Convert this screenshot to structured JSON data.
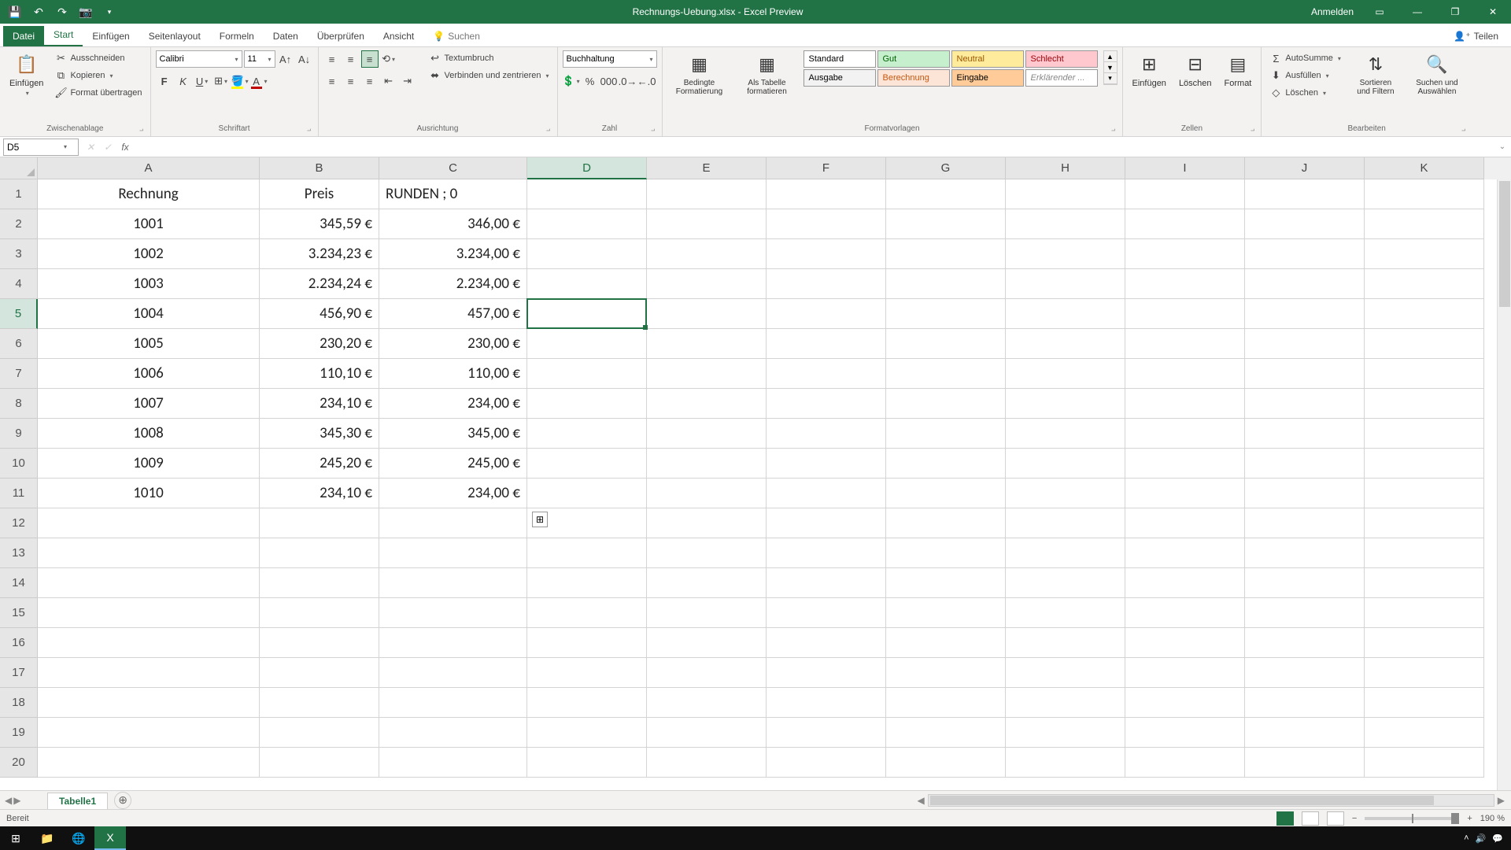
{
  "title": "Rechnungs-Uebung.xlsx - Excel Preview",
  "login": "Anmelden",
  "tabs": {
    "file": "Datei",
    "home": "Start",
    "insert": "Einfügen",
    "page": "Seitenlayout",
    "formulas": "Formeln",
    "data": "Daten",
    "review": "Überprüfen",
    "view": "Ansicht",
    "search": "Suchen",
    "share": "Teilen"
  },
  "clipboard": {
    "paste": "Einfügen",
    "cut": "Ausschneiden",
    "copy": "Kopieren",
    "painter": "Format übertragen",
    "label": "Zwischenablage"
  },
  "font": {
    "name": "Calibri",
    "size": "11",
    "label": "Schriftart"
  },
  "align": {
    "wrap": "Textumbruch",
    "merge": "Verbinden und zentrieren",
    "label": "Ausrichtung"
  },
  "number": {
    "format": "Buchhaltung",
    "label": "Zahl"
  },
  "styles": {
    "cond": "Bedingte Formatierung",
    "table": "Als Tabelle formatieren",
    "standard": "Standard",
    "gut": "Gut",
    "neutral": "Neutral",
    "schlecht": "Schlecht",
    "ausgabe": "Ausgabe",
    "berechnung": "Berechnung",
    "eingabe": "Eingabe",
    "erklar": "Erklärender ...",
    "label": "Formatvorlagen"
  },
  "cells": {
    "insert": "Einfügen",
    "delete": "Löschen",
    "format": "Format",
    "label": "Zellen"
  },
  "editing": {
    "sum": "AutoSumme",
    "fill": "Ausfüllen",
    "clear": "Löschen",
    "sort": "Sortieren und Filtern",
    "find": "Suchen und Auswählen",
    "label": "Bearbeiten"
  },
  "namebox": "D5",
  "formula": "",
  "columns": [
    "A",
    "B",
    "C",
    "D",
    "E",
    "F",
    "G",
    "H",
    "I",
    "J",
    "K"
  ],
  "colWidths": [
    "cA",
    "cB",
    "cC",
    "cD",
    "cE",
    "cF",
    "cG",
    "cH",
    "cI",
    "cJ",
    "cK"
  ],
  "selectedCol": 3,
  "selectedRow": 4,
  "rows": [
    {
      "n": "1",
      "cells": [
        {
          "v": "Rechnung",
          "a": "ac"
        },
        {
          "v": "Preis",
          "a": "ac"
        },
        {
          "v": "RUNDEN ; 0",
          "a": "al"
        },
        {
          "v": ""
        },
        {
          "v": ""
        },
        {
          "v": ""
        },
        {
          "v": ""
        },
        {
          "v": ""
        },
        {
          "v": ""
        },
        {
          "v": ""
        },
        {
          "v": ""
        }
      ]
    },
    {
      "n": "2",
      "cells": [
        {
          "v": "1001",
          "a": "ac"
        },
        {
          "v": "345,59 €",
          "a": "ar"
        },
        {
          "v": "346,00 €",
          "a": "ar"
        },
        {
          "v": ""
        },
        {
          "v": ""
        },
        {
          "v": ""
        },
        {
          "v": ""
        },
        {
          "v": ""
        },
        {
          "v": ""
        },
        {
          "v": ""
        },
        {
          "v": ""
        }
      ]
    },
    {
      "n": "3",
      "cells": [
        {
          "v": "1002",
          "a": "ac"
        },
        {
          "v": "3.234,23 €",
          "a": "ar"
        },
        {
          "v": "3.234,00 €",
          "a": "ar"
        },
        {
          "v": ""
        },
        {
          "v": ""
        },
        {
          "v": ""
        },
        {
          "v": ""
        },
        {
          "v": ""
        },
        {
          "v": ""
        },
        {
          "v": ""
        },
        {
          "v": ""
        }
      ]
    },
    {
      "n": "4",
      "cells": [
        {
          "v": "1003",
          "a": "ac"
        },
        {
          "v": "2.234,24 €",
          "a": "ar"
        },
        {
          "v": "2.234,00 €",
          "a": "ar"
        },
        {
          "v": ""
        },
        {
          "v": ""
        },
        {
          "v": ""
        },
        {
          "v": ""
        },
        {
          "v": ""
        },
        {
          "v": ""
        },
        {
          "v": ""
        },
        {
          "v": ""
        }
      ]
    },
    {
      "n": "5",
      "cells": [
        {
          "v": "1004",
          "a": "ac"
        },
        {
          "v": "456,90 €",
          "a": "ar"
        },
        {
          "v": "457,00 €",
          "a": "ar"
        },
        {
          "v": ""
        },
        {
          "v": ""
        },
        {
          "v": ""
        },
        {
          "v": ""
        },
        {
          "v": ""
        },
        {
          "v": ""
        },
        {
          "v": ""
        },
        {
          "v": ""
        }
      ]
    },
    {
      "n": "6",
      "cells": [
        {
          "v": "1005",
          "a": "ac"
        },
        {
          "v": "230,20 €",
          "a": "ar"
        },
        {
          "v": "230,00 €",
          "a": "ar"
        },
        {
          "v": ""
        },
        {
          "v": ""
        },
        {
          "v": ""
        },
        {
          "v": ""
        },
        {
          "v": ""
        },
        {
          "v": ""
        },
        {
          "v": ""
        },
        {
          "v": ""
        }
      ]
    },
    {
      "n": "7",
      "cells": [
        {
          "v": "1006",
          "a": "ac"
        },
        {
          "v": "110,10 €",
          "a": "ar"
        },
        {
          "v": "110,00 €",
          "a": "ar"
        },
        {
          "v": ""
        },
        {
          "v": ""
        },
        {
          "v": ""
        },
        {
          "v": ""
        },
        {
          "v": ""
        },
        {
          "v": ""
        },
        {
          "v": ""
        },
        {
          "v": ""
        }
      ]
    },
    {
      "n": "8",
      "cells": [
        {
          "v": "1007",
          "a": "ac"
        },
        {
          "v": "234,10 €",
          "a": "ar"
        },
        {
          "v": "234,00 €",
          "a": "ar"
        },
        {
          "v": ""
        },
        {
          "v": ""
        },
        {
          "v": ""
        },
        {
          "v": ""
        },
        {
          "v": ""
        },
        {
          "v": ""
        },
        {
          "v": ""
        },
        {
          "v": ""
        }
      ]
    },
    {
      "n": "9",
      "cells": [
        {
          "v": "1008",
          "a": "ac"
        },
        {
          "v": "345,30 €",
          "a": "ar"
        },
        {
          "v": "345,00 €",
          "a": "ar"
        },
        {
          "v": ""
        },
        {
          "v": ""
        },
        {
          "v": ""
        },
        {
          "v": ""
        },
        {
          "v": ""
        },
        {
          "v": ""
        },
        {
          "v": ""
        },
        {
          "v": ""
        }
      ]
    },
    {
      "n": "10",
      "cells": [
        {
          "v": "1009",
          "a": "ac"
        },
        {
          "v": "245,20 €",
          "a": "ar"
        },
        {
          "v": "245,00 €",
          "a": "ar"
        },
        {
          "v": ""
        },
        {
          "v": ""
        },
        {
          "v": ""
        },
        {
          "v": ""
        },
        {
          "v": ""
        },
        {
          "v": ""
        },
        {
          "v": ""
        },
        {
          "v": ""
        }
      ]
    },
    {
      "n": "11",
      "cells": [
        {
          "v": "1010",
          "a": "ac"
        },
        {
          "v": "234,10 €",
          "a": "ar"
        },
        {
          "v": "234,00 €",
          "a": "ar"
        },
        {
          "v": ""
        },
        {
          "v": ""
        },
        {
          "v": ""
        },
        {
          "v": ""
        },
        {
          "v": ""
        },
        {
          "v": ""
        },
        {
          "v": ""
        },
        {
          "v": ""
        }
      ]
    },
    {
      "n": "12",
      "cells": [
        {
          "v": ""
        },
        {
          "v": ""
        },
        {
          "v": ""
        },
        {
          "v": ""
        },
        {
          "v": ""
        },
        {
          "v": ""
        },
        {
          "v": ""
        },
        {
          "v": ""
        },
        {
          "v": ""
        },
        {
          "v": ""
        },
        {
          "v": ""
        }
      ]
    },
    {
      "n": "13",
      "cells": [
        {
          "v": ""
        },
        {
          "v": ""
        },
        {
          "v": ""
        },
        {
          "v": ""
        },
        {
          "v": ""
        },
        {
          "v": ""
        },
        {
          "v": ""
        },
        {
          "v": ""
        },
        {
          "v": ""
        },
        {
          "v": ""
        },
        {
          "v": ""
        }
      ]
    },
    {
      "n": "14",
      "cells": [
        {
          "v": ""
        },
        {
          "v": ""
        },
        {
          "v": ""
        },
        {
          "v": ""
        },
        {
          "v": ""
        },
        {
          "v": ""
        },
        {
          "v": ""
        },
        {
          "v": ""
        },
        {
          "v": ""
        },
        {
          "v": ""
        },
        {
          "v": ""
        }
      ]
    },
    {
      "n": "15",
      "cells": [
        {
          "v": ""
        },
        {
          "v": ""
        },
        {
          "v": ""
        },
        {
          "v": ""
        },
        {
          "v": ""
        },
        {
          "v": ""
        },
        {
          "v": ""
        },
        {
          "v": ""
        },
        {
          "v": ""
        },
        {
          "v": ""
        },
        {
          "v": ""
        }
      ]
    },
    {
      "n": "16",
      "cells": [
        {
          "v": ""
        },
        {
          "v": ""
        },
        {
          "v": ""
        },
        {
          "v": ""
        },
        {
          "v": ""
        },
        {
          "v": ""
        },
        {
          "v": ""
        },
        {
          "v": ""
        },
        {
          "v": ""
        },
        {
          "v": ""
        },
        {
          "v": ""
        }
      ]
    },
    {
      "n": "17",
      "cells": [
        {
          "v": ""
        },
        {
          "v": ""
        },
        {
          "v": ""
        },
        {
          "v": ""
        },
        {
          "v": ""
        },
        {
          "v": ""
        },
        {
          "v": ""
        },
        {
          "v": ""
        },
        {
          "v": ""
        },
        {
          "v": ""
        },
        {
          "v": ""
        }
      ]
    },
    {
      "n": "18",
      "cells": [
        {
          "v": ""
        },
        {
          "v": ""
        },
        {
          "v": ""
        },
        {
          "v": ""
        },
        {
          "v": ""
        },
        {
          "v": ""
        },
        {
          "v": ""
        },
        {
          "v": ""
        },
        {
          "v": ""
        },
        {
          "v": ""
        },
        {
          "v": ""
        }
      ]
    },
    {
      "n": "19",
      "cells": [
        {
          "v": ""
        },
        {
          "v": ""
        },
        {
          "v": ""
        },
        {
          "v": ""
        },
        {
          "v": ""
        },
        {
          "v": ""
        },
        {
          "v": ""
        },
        {
          "v": ""
        },
        {
          "v": ""
        },
        {
          "v": ""
        },
        {
          "v": ""
        }
      ]
    },
    {
      "n": "20",
      "cells": [
        {
          "v": ""
        },
        {
          "v": ""
        },
        {
          "v": ""
        },
        {
          "v": ""
        },
        {
          "v": ""
        },
        {
          "v": ""
        },
        {
          "v": ""
        },
        {
          "v": ""
        },
        {
          "v": ""
        },
        {
          "v": ""
        },
        {
          "v": ""
        }
      ]
    }
  ],
  "sheet": "Tabelle1",
  "status": "Bereit",
  "zoom": "190 %"
}
